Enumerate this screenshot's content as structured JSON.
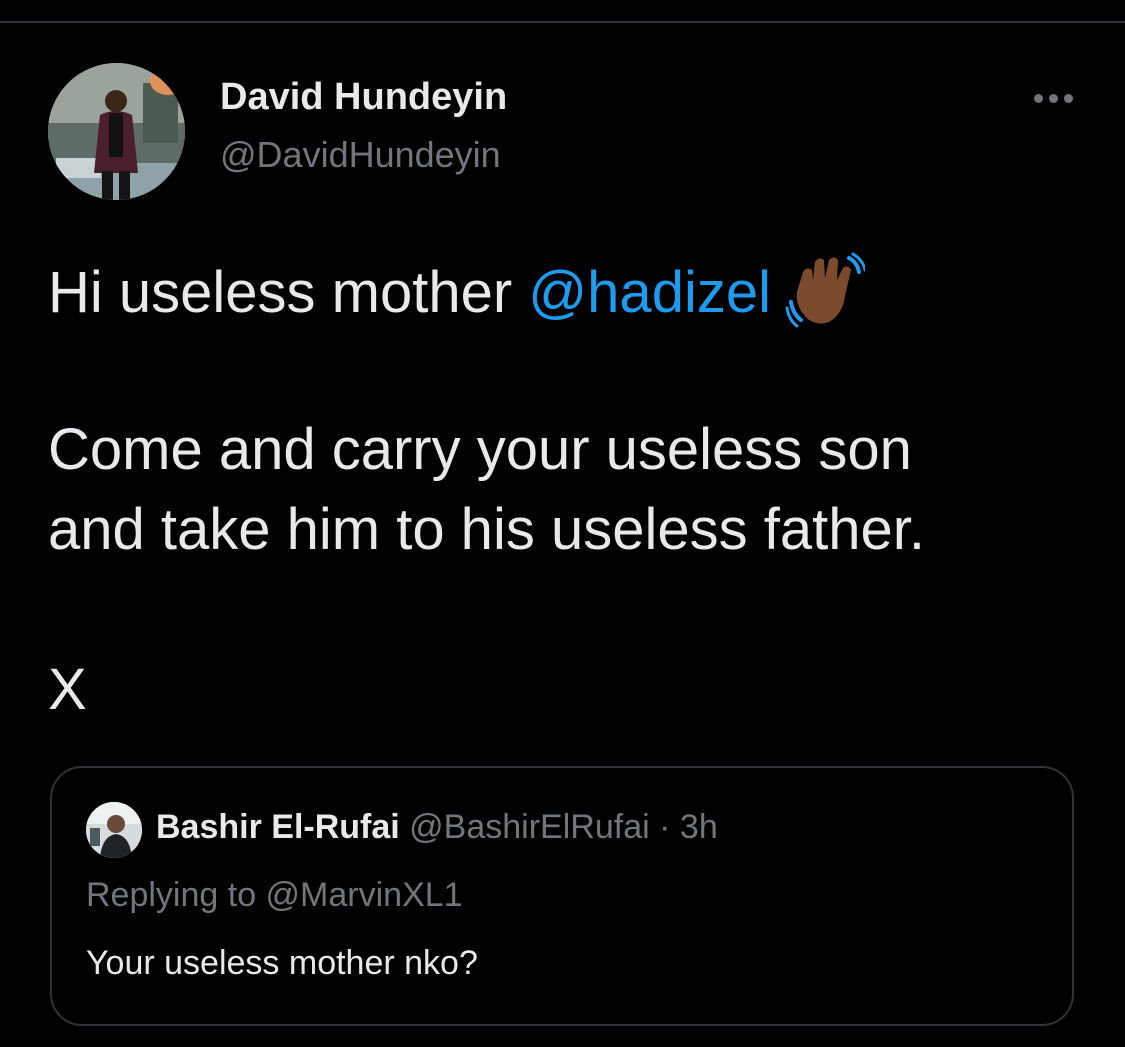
{
  "tweet": {
    "author": {
      "name": "David Hundeyin",
      "handle": "@DavidHundeyin"
    },
    "body": {
      "line1_prefix": "Hi useless mother ",
      "mention": "@hadizel",
      "line2": "Come and carry your useless son",
      "line3": "and take him to his useless father.",
      "line4": "X"
    },
    "more_icon": "more-horizontal-icon",
    "emoji": "waving-hand-medium-dark-skin-tone"
  },
  "quoted_tweet": {
    "name": "Bashir El-Rufai",
    "handle": "@BashirElRufai",
    "separator": "·",
    "time": "3h",
    "replying_to": "Replying to @MarvinXL1",
    "text": "Your useless mother nko?"
  },
  "colors": {
    "background": "#000000",
    "text": "#e7e9ea",
    "secondary": "#71767b",
    "link": "#1d9bf0",
    "border": "#2f3336"
  }
}
